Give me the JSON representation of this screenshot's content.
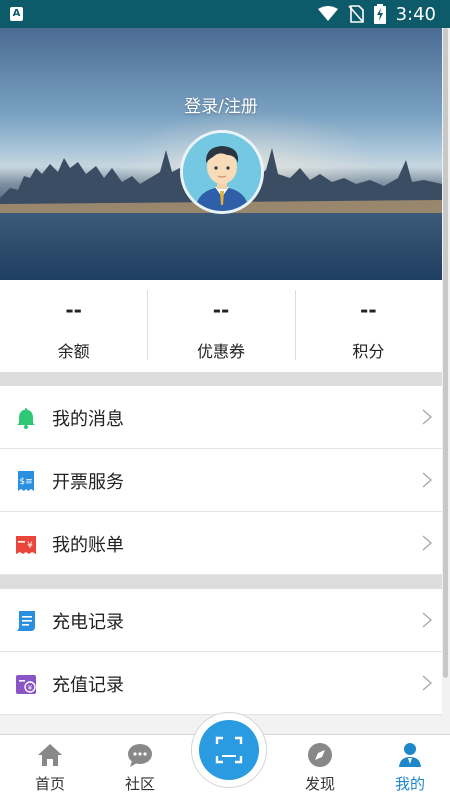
{
  "status_bar": {
    "time": "3:40",
    "icons": [
      "a-notification-icon",
      "wifi-icon",
      "no-sim-icon",
      "battery-charging-icon"
    ]
  },
  "hero": {
    "login_label": "登录/注册",
    "avatar_icon": "user-avatar-icon"
  },
  "stats": [
    {
      "value": "--",
      "label": "余额"
    },
    {
      "value": "--",
      "label": "优惠券"
    },
    {
      "value": "--",
      "label": "积分"
    }
  ],
  "menu_group_1": [
    {
      "label": "我的消息",
      "icon": "bell-icon",
      "color": "#2ec776"
    },
    {
      "label": "开票服务",
      "icon": "invoice-icon",
      "color": "#2b8fe0"
    },
    {
      "label": "我的账单",
      "icon": "bill-icon",
      "color": "#e9453a"
    }
  ],
  "menu_group_2": [
    {
      "label": "充电记录",
      "icon": "charge-record-icon",
      "color": "#2b8fe0"
    },
    {
      "label": "充值记录",
      "icon": "recharge-record-icon",
      "color": "#8b54c7"
    }
  ],
  "tab_bar": {
    "tabs": [
      {
        "label": "首页",
        "icon": "home-icon"
      },
      {
        "label": "社区",
        "icon": "chat-icon"
      },
      {
        "label": "发现",
        "icon": "compass-icon"
      },
      {
        "label": "我的",
        "icon": "profile-icon",
        "active": true
      }
    ],
    "scan_icon": "scan-icon",
    "accent": "#1f86c8"
  }
}
